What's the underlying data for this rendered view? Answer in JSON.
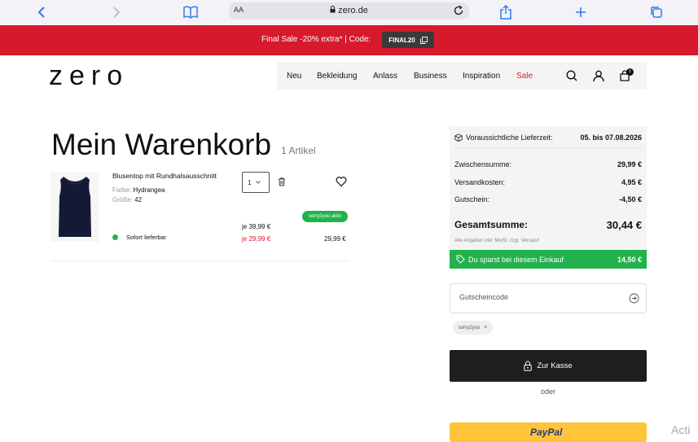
{
  "browser": {
    "text_size": "AA",
    "url": "zero.de"
  },
  "promo": {
    "text": "Final Sale -20% extra* | Code:",
    "code": "FINAL20"
  },
  "header": {
    "logo": "zero",
    "nav": [
      "Neu",
      "Bekleidung",
      "Anlass",
      "Business",
      "Inspiration",
      "Sale"
    ],
    "cart_count": "1"
  },
  "cart": {
    "title": "Mein Warenkorb",
    "item_count": "1 Artikel",
    "item": {
      "name": "Blusentop mit Rundhalsausschnitt",
      "color_label": "Farbe:",
      "color": "Hydrangea",
      "size_label": "Größe:",
      "size": "42",
      "qty": "1",
      "badge": "sorry2you aktiv",
      "old_price": "je 39,99 €",
      "new_price": "je 29,99 €",
      "total": "29,99 €",
      "stock": "Sofort lieferbar"
    }
  },
  "summary": {
    "delivery_label": "Voraussichtliche Lieferzeit:",
    "delivery_value": "05. bis 07.08.2026",
    "subtotal_label": "Zwischensumme:",
    "subtotal": "29,99 €",
    "shipping_label": "Versandkosten:",
    "shipping": "4,95 €",
    "voucher_label": "Gutschein:",
    "voucher": "-4,50 €",
    "total_label": "Gesamtsumme:",
    "total": "30,44 €",
    "vat_note": "Alle Angaben inkl. MwSt. zzgl. Versand",
    "savings_label": "Du sparst bei diesem Einkauf",
    "savings": "14,50 €"
  },
  "voucher": {
    "placeholder": "Gutscheincode",
    "applied_code": "sorry2you"
  },
  "checkout": {
    "label": "Zur Kasse",
    "or": "oder",
    "paypal": "PayPal"
  },
  "overlay_text": "Acti",
  "colors": {
    "brand_red": "#d6192c",
    "success_green": "#22b24c",
    "dark": "#1e1e1e",
    "paypal_yellow": "#ffc439",
    "ios_blue": "#2e7bf6"
  }
}
